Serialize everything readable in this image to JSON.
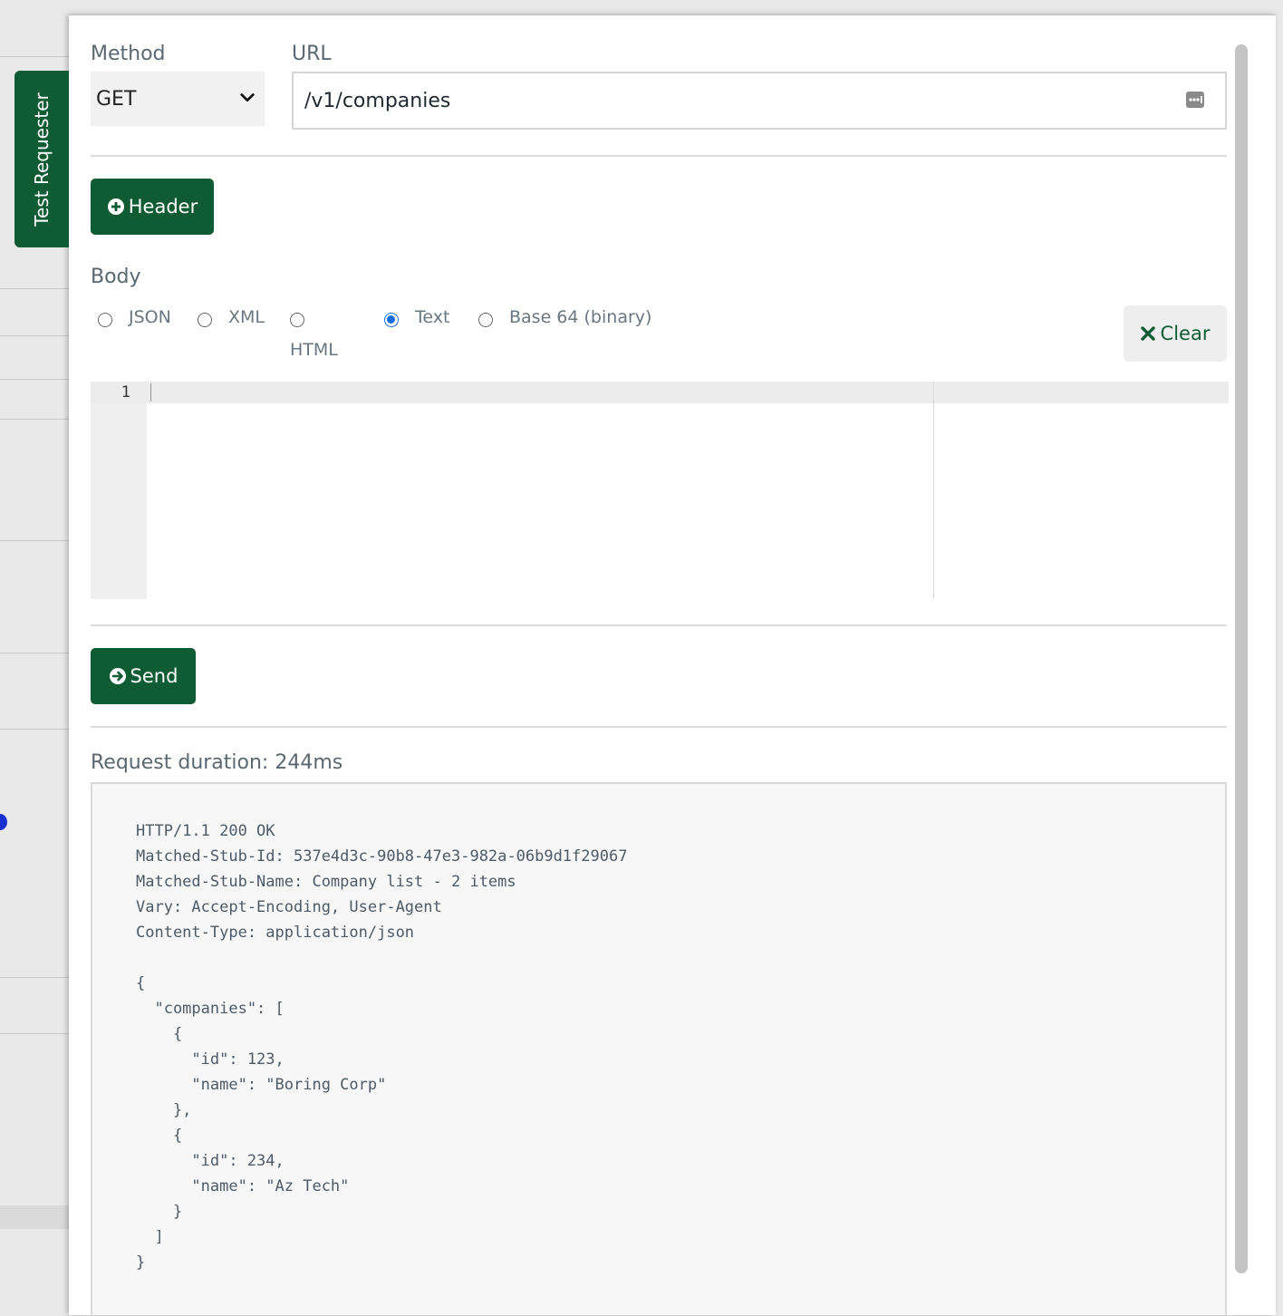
{
  "side_tab": {
    "label": "Test Requester"
  },
  "request": {
    "method_label": "Method",
    "method_value": "GET",
    "url_label": "URL",
    "url_value": "/v1/companies",
    "header_button": "Header",
    "body_label": "Body",
    "body_types": [
      {
        "label": "JSON",
        "selected": false
      },
      {
        "label": "XML",
        "selected": false
      },
      {
        "label": "HTML",
        "selected": false
      },
      {
        "label": "Text",
        "selected": true
      },
      {
        "label": "Base 64 (binary)",
        "selected": false
      }
    ],
    "clear_button": "Clear",
    "editor_line_number": "1",
    "send_button": "Send"
  },
  "response": {
    "duration": "Request duration: 244ms",
    "lines": [
      "HTTP/1.1 200 OK",
      "Matched-Stub-Id: 537e4d3c-90b8-47e3-982a-06b9d1f29067",
      "Matched-Stub-Name: Company list - 2 items",
      "Vary: Accept-Encoding, User-Agent",
      "Content-Type: application/json",
      "",
      "{",
      "  \"companies\": [",
      "    {",
      "      \"id\": 123,",
      "      \"name\": \"Boring Corp\"",
      "    },",
      "    {",
      "      \"id\": 234,",
      "      \"name\": \"Az Tech\"",
      "    }",
      "  ]",
      "}"
    ]
  },
  "colors": {
    "primary_green": "#0f5c34",
    "radio_selected": "#1a6fe0"
  },
  "icons": {
    "header_button": "plus-circle-icon",
    "send_button": "arrow-circle-right-icon",
    "clear_button": "x-icon",
    "method_select": "chevron-down-icon",
    "url_input": "more-icon"
  }
}
